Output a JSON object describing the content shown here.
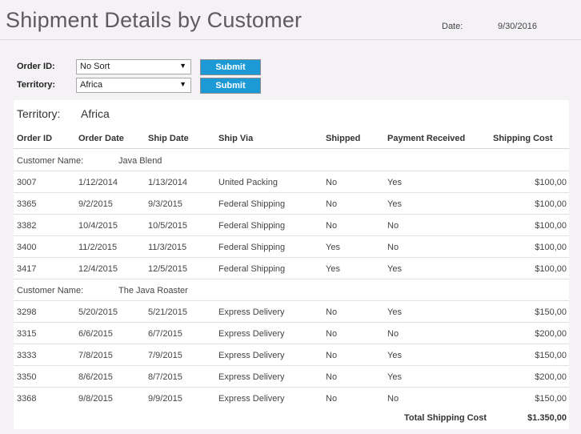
{
  "header": {
    "title": "Shipment Details by Customer",
    "date_label": "Date:",
    "date_value": "9/30/2016"
  },
  "filters": {
    "order_id": {
      "label": "Order ID:",
      "selected": "No Sort",
      "button": "Submit"
    },
    "territory": {
      "label": "Territory:",
      "selected": "Africa",
      "button": "Submit"
    }
  },
  "report": {
    "territory_label": "Territory:",
    "territory_value": "Africa",
    "columns": [
      "Order ID",
      "Order Date",
      "Ship Date",
      "Ship Via",
      "Shipped",
      "Payment Received",
      "Shipping Cost"
    ],
    "groups": [
      {
        "label": "Customer Name:",
        "name": "Java Blend",
        "rows": [
          [
            "3007",
            "1/12/2014",
            "1/13/2014",
            "United Packing",
            "No",
            "Yes",
            "$100,00"
          ],
          [
            "3365",
            "9/2/2015",
            "9/3/2015",
            "Federal Shipping",
            "No",
            "Yes",
            "$100,00"
          ],
          [
            "3382",
            "10/4/2015",
            "10/5/2015",
            "Federal Shipping",
            "No",
            "No",
            "$100,00"
          ],
          [
            "3400",
            "11/2/2015",
            "11/3/2015",
            "Federal Shipping",
            "Yes",
            "No",
            "$100,00"
          ],
          [
            "3417",
            "12/4/2015",
            "12/5/2015",
            "Federal Shipping",
            "Yes",
            "Yes",
            "$100,00"
          ]
        ]
      },
      {
        "label": "Customer Name:",
        "name": "The Java Roaster",
        "rows": [
          [
            "3298",
            "5/20/2015",
            "5/21/2015",
            "Express Delivery",
            "No",
            "Yes",
            "$150,00"
          ],
          [
            "3315",
            "6/6/2015",
            "6/7/2015",
            "Express Delivery",
            "No",
            "No",
            "$200,00"
          ],
          [
            "3333",
            "7/8/2015",
            "7/9/2015",
            "Express Delivery",
            "No",
            "Yes",
            "$150,00"
          ],
          [
            "3350",
            "8/6/2015",
            "8/7/2015",
            "Express Delivery",
            "No",
            "Yes",
            "$200,00"
          ],
          [
            "3368",
            "9/8/2015",
            "9/9/2015",
            "Express Delivery",
            "No",
            "No",
            "$150,00"
          ]
        ]
      }
    ],
    "total_label": "Total Shipping Cost",
    "total_value": "$1.350,00"
  }
}
